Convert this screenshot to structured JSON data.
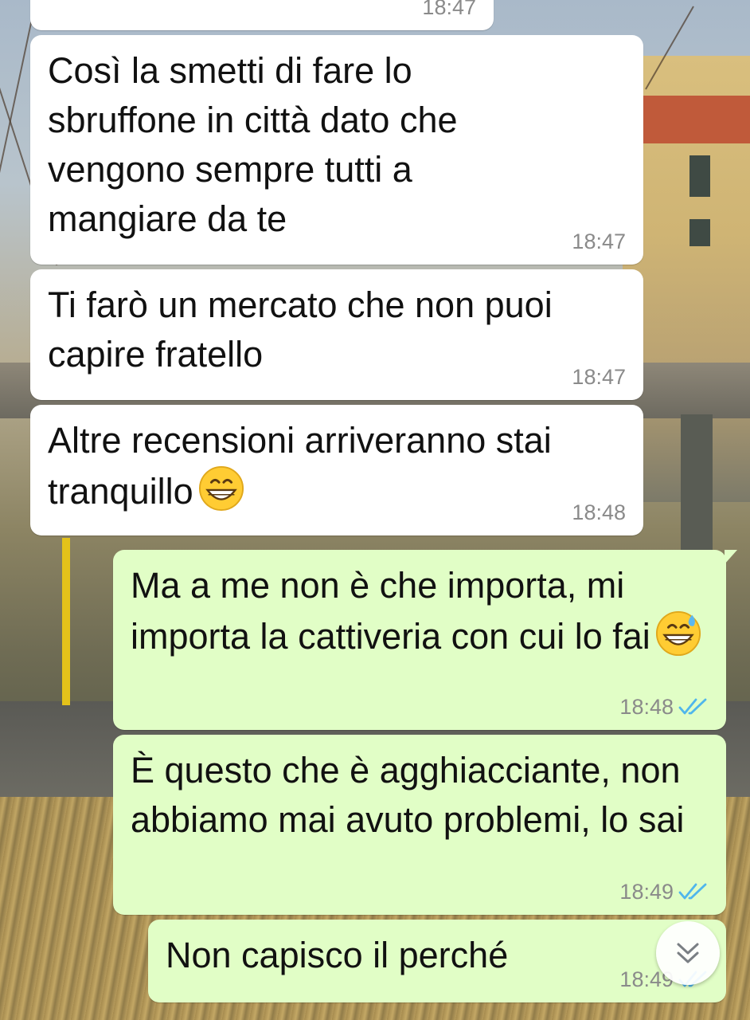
{
  "conversation": {
    "messages": [
      {
        "direction": "incoming",
        "text": "Così la smetti di fare lo sbruffone in città dato che vengono sempre tutti a mangiare da te",
        "time": "18:47"
      },
      {
        "direction": "incoming",
        "text": "Ti farò un mercato che non puoi capire fratello",
        "time": "18:47"
      },
      {
        "direction": "incoming",
        "text": "Altre recensioni arriveranno stai tranquillo",
        "time": "18:48",
        "emoji": "grinning-face-with-smiling-eyes"
      },
      {
        "direction": "outgoing",
        "text": "Ma a me non è che importa, mi importa la cattiveria con cui lo fai",
        "time": "18:48",
        "emoji": "grinning-face-with-sweat",
        "status": "read"
      },
      {
        "direction": "outgoing",
        "text": "È questo che è agghiacciante, non abbiamo mai avuto problemi, lo sai",
        "time": "18:49",
        "status": "read"
      },
      {
        "direction": "outgoing",
        "text": "Non capisco il perché",
        "time": "18:49",
        "status": "read"
      }
    ],
    "partial_top_time": "18:47"
  },
  "colors": {
    "incoming_bubble": "#ffffff",
    "outgoing_bubble": "#e1fec6",
    "read_ticks": "#4fb6ec",
    "timestamp": "#8a8a8a"
  },
  "icons": {
    "read_receipt": "double-check-icon",
    "scroll_down": "double-chevron-down-icon"
  }
}
